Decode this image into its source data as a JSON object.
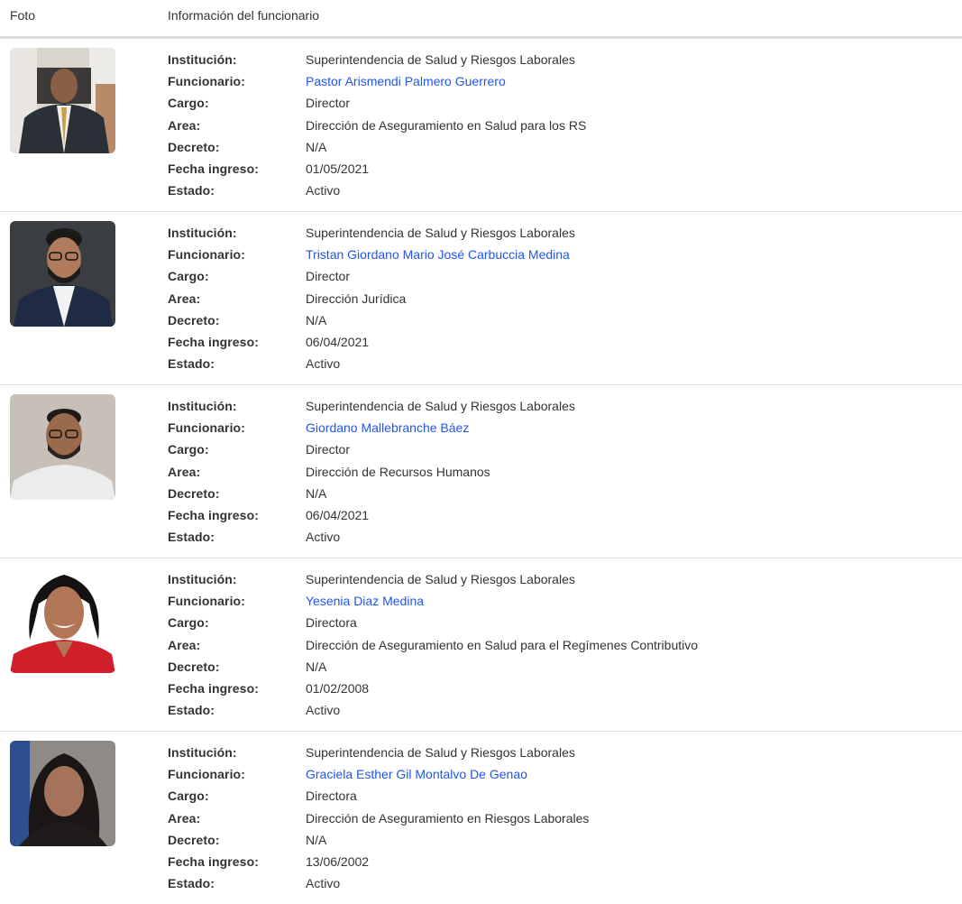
{
  "header": {
    "photo_col": "Foto",
    "info_col": "Información del funcionario"
  },
  "labels": {
    "institucion": "Institución:",
    "funcionario": "Funcionario:",
    "cargo": "Cargo:",
    "area": "Area:",
    "decreto": "Decreto:",
    "fecha_ingreso": "Fecha ingreso:",
    "estado": "Estado:"
  },
  "rows": [
    {
      "institucion": "Superintendencia de Salud y Riesgos Laborales",
      "funcionario": "Pastor Arismendi Palmero Guerrero",
      "cargo": "Director",
      "area": "Dirección de Aseguramiento en Salud para los RS",
      "decreto": "N/A",
      "fecha_ingreso": "01/05/2021",
      "estado": "Activo"
    },
    {
      "institucion": "Superintendencia de Salud y Riesgos Laborales",
      "funcionario": "Tristan Giordano Mario José Carbuccia Medina",
      "cargo": "Director",
      "area": "Dirección Jurídica",
      "decreto": "N/A",
      "fecha_ingreso": "06/04/2021",
      "estado": "Activo"
    },
    {
      "institucion": "Superintendencia de Salud y Riesgos Laborales",
      "funcionario": "Giordano Mallebranche Báez",
      "cargo": "Director",
      "area": "Dirección de Recursos Humanos",
      "decreto": "N/A",
      "fecha_ingreso": "06/04/2021",
      "estado": "Activo"
    },
    {
      "institucion": "Superintendencia de Salud y Riesgos Laborales",
      "funcionario": "Yesenia Diaz Medina",
      "cargo": "Directora",
      "area": "Dirección de Aseguramiento en Salud para el Regímenes Contributivo",
      "decreto": "N/A",
      "fecha_ingreso": "01/02/2008",
      "estado": "Activo"
    },
    {
      "institucion": "Superintendencia de Salud y Riesgos Laborales",
      "funcionario": "Graciela Esther Gil Montalvo De Genao",
      "cargo": "Directora",
      "area": "Dirección de Aseguramiento en Riesgos Laborales",
      "decreto": "N/A",
      "fecha_ingreso": "13/06/2002",
      "estado": "Activo"
    }
  ],
  "colors": {
    "link": "#2255ee",
    "text": "#333333",
    "divider": "#dedede"
  }
}
